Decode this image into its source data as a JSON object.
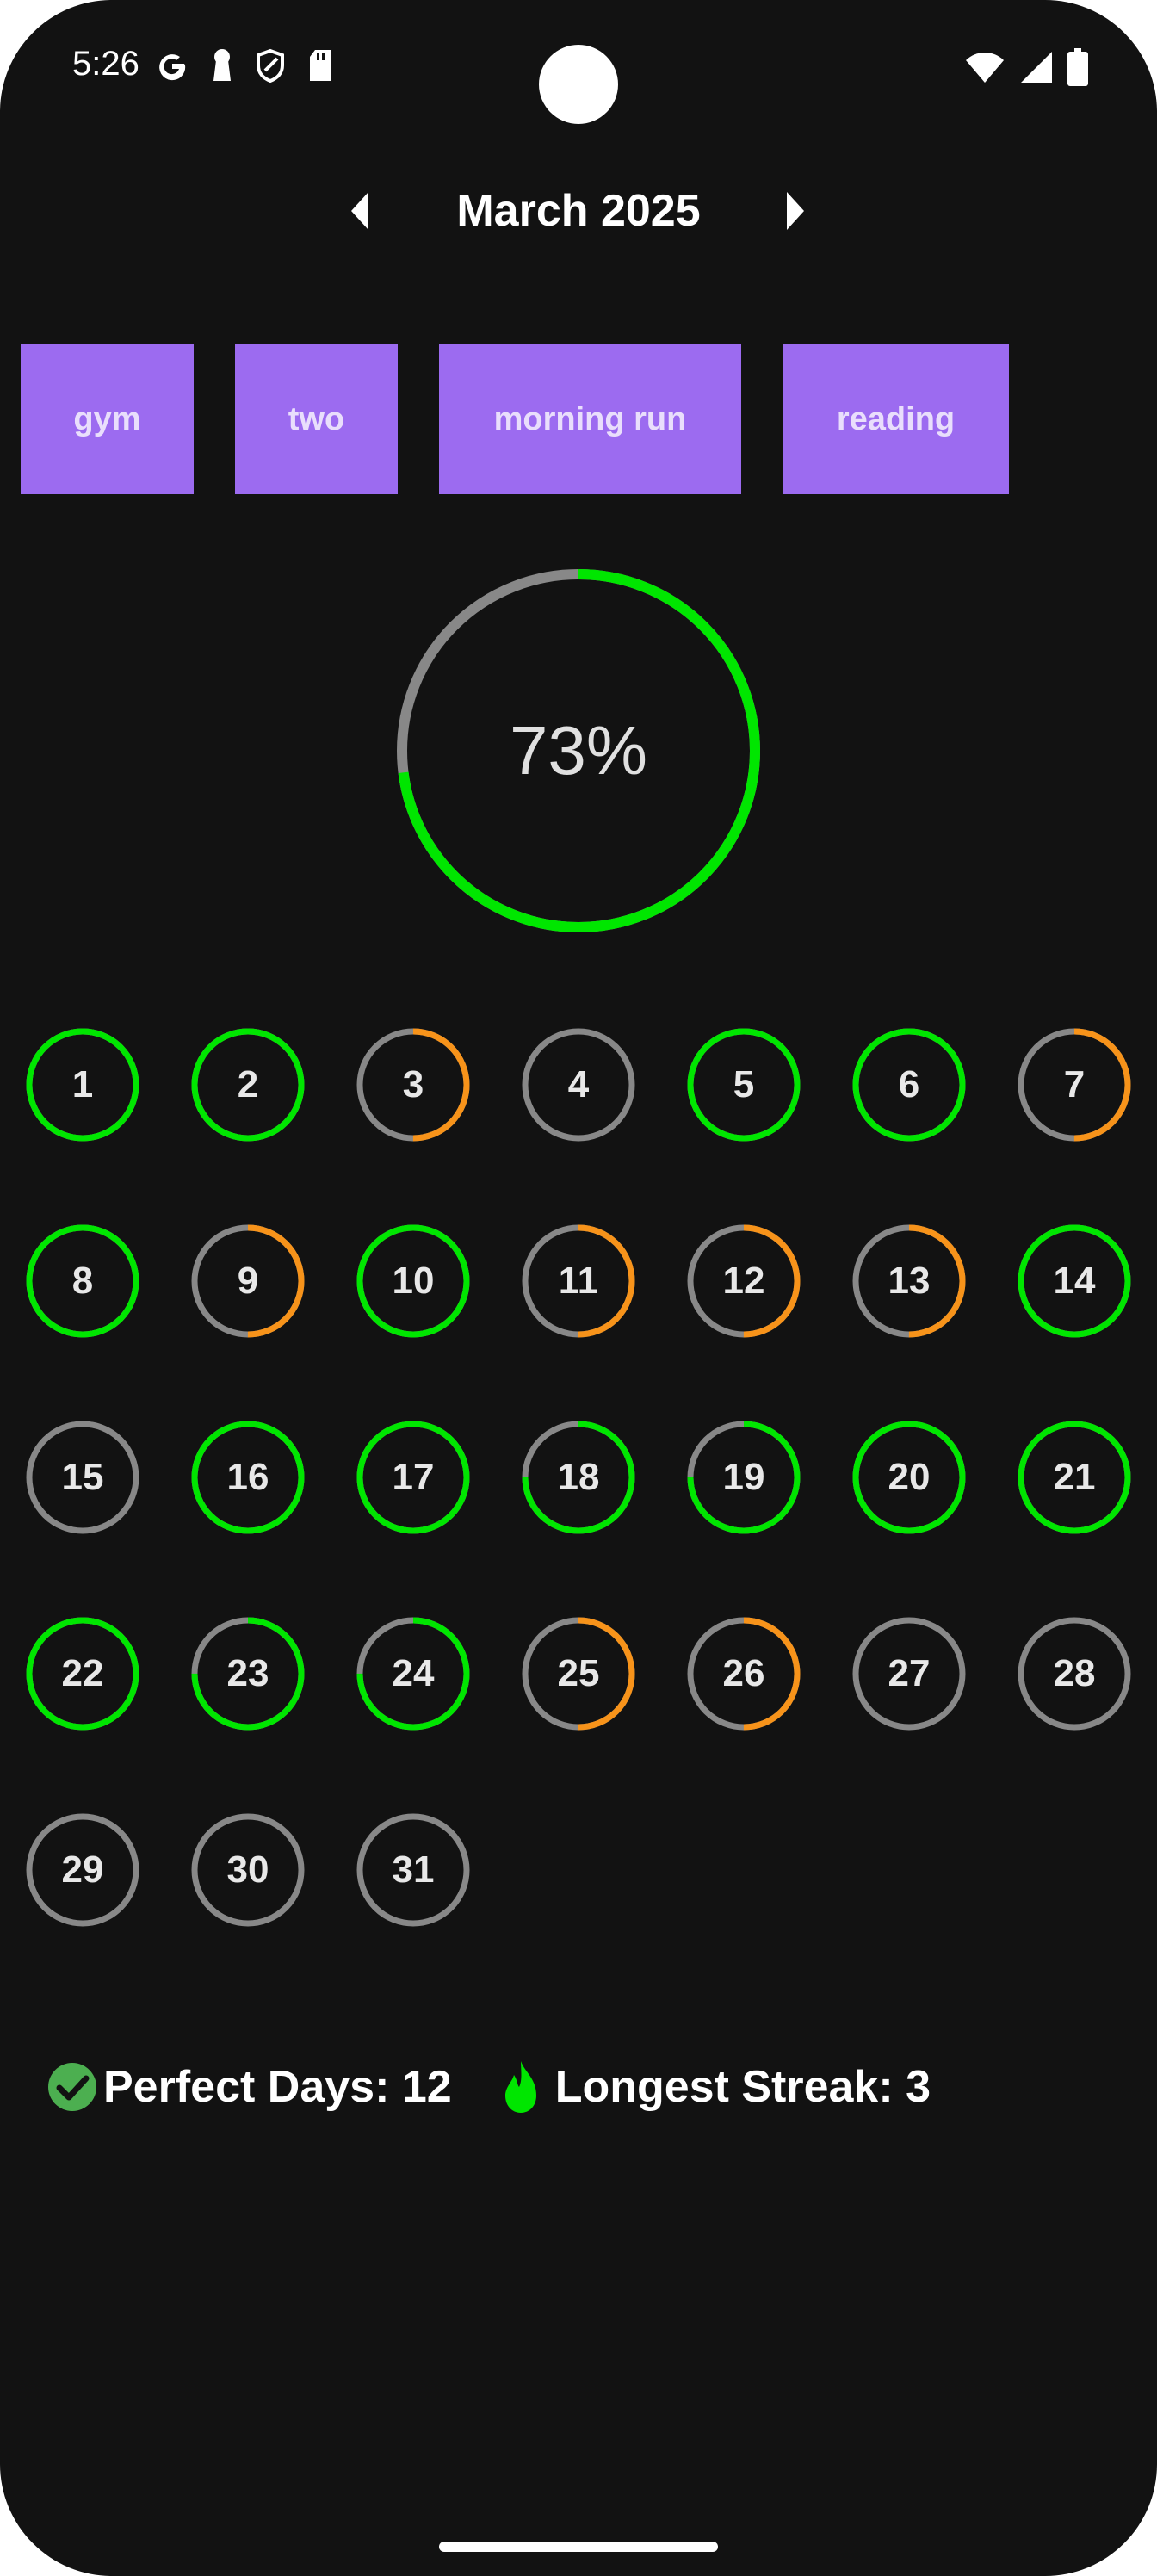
{
  "status_bar": {
    "time": "5:26",
    "left_icons": [
      "google-icon",
      "keyhole-icon",
      "shield-icon",
      "sd-card-icon"
    ],
    "right_icons": [
      "wifi-icon",
      "signal-icon",
      "battery-icon"
    ]
  },
  "header": {
    "month_title": "March 2025",
    "prev_icon": "chevron-left-icon",
    "next_icon": "chevron-right-icon"
  },
  "habits": [
    "gym",
    "two",
    "morning run",
    "reading"
  ],
  "overall_progress": {
    "label": "73%",
    "value": 0.73
  },
  "colors": {
    "background": "#121212",
    "chip": "#9c6bf0",
    "complete": "#00e600",
    "partial_low": "#f7931a",
    "partial_high": "#ff7a00",
    "empty": "#888888"
  },
  "days": [
    {
      "label": "1",
      "progress": 1.0
    },
    {
      "label": "2",
      "progress": 1.0
    },
    {
      "label": "3",
      "progress": 0.5
    },
    {
      "label": "4",
      "progress": 0.0
    },
    {
      "label": "5",
      "progress": 1.0
    },
    {
      "label": "6",
      "progress": 1.0
    },
    {
      "label": "7",
      "progress": 0.5
    },
    {
      "label": "8",
      "progress": 1.0
    },
    {
      "label": "9",
      "progress": 0.5
    },
    {
      "label": "10",
      "progress": 1.0
    },
    {
      "label": "11",
      "progress": 0.5
    },
    {
      "label": "12",
      "progress": 0.5
    },
    {
      "label": "13",
      "progress": 0.5
    },
    {
      "label": "14",
      "progress": 1.0
    },
    {
      "label": "15",
      "progress": 0.0
    },
    {
      "label": "16",
      "progress": 1.0
    },
    {
      "label": "17",
      "progress": 1.0
    },
    {
      "label": "18",
      "progress": 0.75
    },
    {
      "label": "19",
      "progress": 0.75
    },
    {
      "label": "20",
      "progress": 1.0
    },
    {
      "label": "21",
      "progress": 1.0
    },
    {
      "label": "22",
      "progress": 1.0
    },
    {
      "label": "23",
      "progress": 0.75
    },
    {
      "label": "24",
      "progress": 0.75
    },
    {
      "label": "25",
      "progress": 0.5
    },
    {
      "label": "26",
      "progress": 0.5
    },
    {
      "label": "27",
      "progress": 0.0
    },
    {
      "label": "28",
      "progress": 0.0
    },
    {
      "label": "29",
      "progress": 0.0
    },
    {
      "label": "30",
      "progress": 0.0
    },
    {
      "label": "31",
      "progress": 0.0
    }
  ],
  "stats": {
    "perfect_days": "Perfect Days: 12",
    "longest_streak": "Longest Streak: 3"
  }
}
